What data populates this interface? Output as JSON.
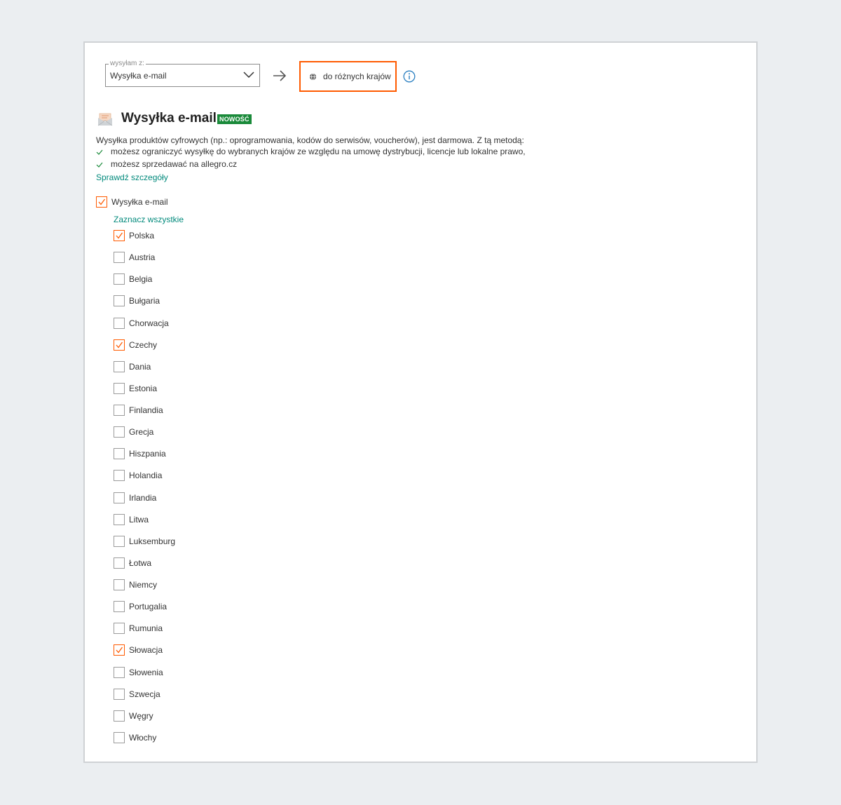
{
  "shipping_from": {
    "legend": "wysyłam z:",
    "value": "Wysyłka e-mail",
    "chevron_icon": "chevron-down-icon"
  },
  "destination": {
    "label": "do różnych krajów",
    "icon": "globe-icon"
  },
  "method": {
    "title": "Wysyłka e-mail",
    "badge": "NOWOŚĆ",
    "badge_color": "#1a8a3a",
    "description": "Wysyłka produktów cyfrowych (np.: oprogramowania, kodów do serwisów, voucherów), jest darmowa. Z tą metodą:",
    "bullets": [
      "możesz ograniczyć wysyłkę do wybranych krajów ze względu na umowę dystrybucji, licencje lub lokalne prawo,",
      "możesz sprzedawać na allegro.cz"
    ],
    "details_link": "Sprawdź szczegóły"
  },
  "main_checkbox": {
    "label": "Wysyłka e-mail",
    "checked": true
  },
  "select_all": "Zaznacz wszystkie",
  "countries": [
    {
      "label": "Polska",
      "checked": true
    },
    {
      "label": "Austria",
      "checked": false
    },
    {
      "label": "Belgia",
      "checked": false
    },
    {
      "label": "Bułgaria",
      "checked": false
    },
    {
      "label": "Chorwacja",
      "checked": false
    },
    {
      "label": "Czechy",
      "checked": true
    },
    {
      "label": "Dania",
      "checked": false
    },
    {
      "label": "Estonia",
      "checked": false
    },
    {
      "label": "Finlandia",
      "checked": false
    },
    {
      "label": "Grecja",
      "checked": false
    },
    {
      "label": "Hiszpania",
      "checked": false
    },
    {
      "label": "Holandia",
      "checked": false
    },
    {
      "label": "Irlandia",
      "checked": false
    },
    {
      "label": "Litwa",
      "checked": false
    },
    {
      "label": "Luksemburg",
      "checked": false
    },
    {
      "label": "Łotwa",
      "checked": false
    },
    {
      "label": "Niemcy",
      "checked": false
    },
    {
      "label": "Portugalia",
      "checked": false
    },
    {
      "label": "Rumunia",
      "checked": false
    },
    {
      "label": "Słowacja",
      "checked": true
    },
    {
      "label": "Słowenia",
      "checked": false
    },
    {
      "label": "Szwecja",
      "checked": false
    },
    {
      "label": "Węgry",
      "checked": false
    },
    {
      "label": "Włochy",
      "checked": false
    }
  ],
  "colors": {
    "accent": "#ff5a00",
    "link": "#00897b",
    "info": "#2a7fc1",
    "success_tick": "#1a8a3a"
  }
}
